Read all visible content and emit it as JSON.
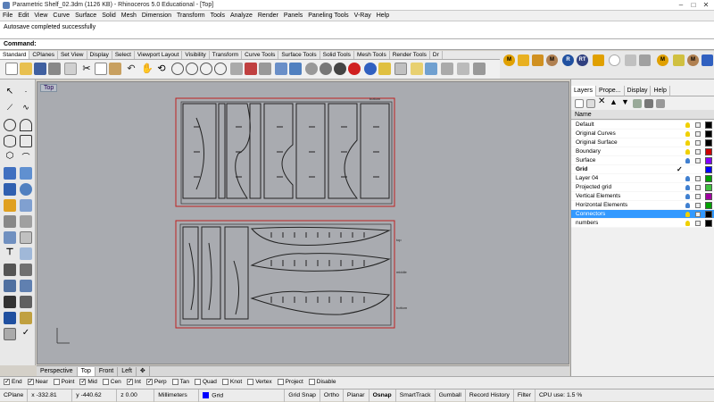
{
  "window": {
    "title": "Parametric Shelf_02.3dm (1126 KB) - Rhinoceros 5.0 Educational - [Top]"
  },
  "menu": [
    "File",
    "Edit",
    "View",
    "Curve",
    "Surface",
    "Solid",
    "Mesh",
    "Dimension",
    "Transform",
    "Tools",
    "Analyze",
    "Render",
    "Panels",
    "Paneling Tools",
    "V-Ray",
    "Help"
  ],
  "history": {
    "line1": "Autosave completed successfully"
  },
  "command": {
    "label": "Command:"
  },
  "toolbar_tabs": [
    "Standard",
    "CPlanes",
    "Set View",
    "Display",
    "Select",
    "Viewport Layout",
    "Visibility",
    "Transform",
    "Curve Tools",
    "Surface Tools",
    "Solid Tools",
    "Mesh Tools",
    "Render Tools",
    "Dr"
  ],
  "extra_tools": [
    "M",
    "M",
    "R",
    "RT",
    "M",
    "M"
  ],
  "viewport": {
    "label": "Top"
  },
  "drawing_labels": {
    "bottom": "bottom",
    "top_label": "top",
    "middle": "middle",
    "bottom2": "bottom"
  },
  "view_tabs": [
    "Perspective",
    "Top",
    "Front",
    "Left"
  ],
  "panel_tabs": [
    "Layers",
    "Prope...",
    "Display",
    "Help"
  ],
  "layers_header": "Name",
  "layers": [
    {
      "name": "Default",
      "color": "#000000"
    },
    {
      "name": "Original Curves",
      "color": "#000000"
    },
    {
      "name": "Original Surface",
      "color": "#000000"
    },
    {
      "name": "Boundary",
      "color": "#cc0000"
    },
    {
      "name": "Surface",
      "color": "#8000ff"
    },
    {
      "name": "Grid",
      "color": "#0000ff"
    },
    {
      "name": "Layer 04",
      "color": "#00a000"
    },
    {
      "name": "Projected grid",
      "color": "#40c040"
    },
    {
      "name": "Vertical Elements",
      "color": "#a000a0"
    },
    {
      "name": "Horizontal Elements",
      "color": "#00a000"
    },
    {
      "name": "Connectors",
      "color": "#000000"
    },
    {
      "name": "numbers",
      "color": "#000000"
    }
  ],
  "osnaps": [
    {
      "label": "End",
      "on": true
    },
    {
      "label": "Near",
      "on": true
    },
    {
      "label": "Point",
      "on": false
    },
    {
      "label": "Mid",
      "on": true
    },
    {
      "label": "Cen",
      "on": false
    },
    {
      "label": "Int",
      "on": true
    },
    {
      "label": "Perp",
      "on": true
    },
    {
      "label": "Tan",
      "on": false
    },
    {
      "label": "Quad",
      "on": false
    },
    {
      "label": "Knot",
      "on": false
    },
    {
      "label": "Vertex",
      "on": false
    },
    {
      "label": "Project",
      "on": false
    },
    {
      "label": "Disable",
      "on": false
    }
  ],
  "status": {
    "cplane": "CPlane",
    "x": "x -332.81",
    "y": "y -440.62",
    "z": "z 0.00",
    "units": "Millimeters",
    "layer": "Grid",
    "grid_snap": "Grid Snap",
    "ortho": "Ortho",
    "planar": "Planar",
    "osnap": "Osnap",
    "smarttrack": "SmartTrack",
    "gumball": "Gumball",
    "record_history": "Record History",
    "filter": "Filter",
    "cpu": "CPU use: 1.5 %"
  }
}
